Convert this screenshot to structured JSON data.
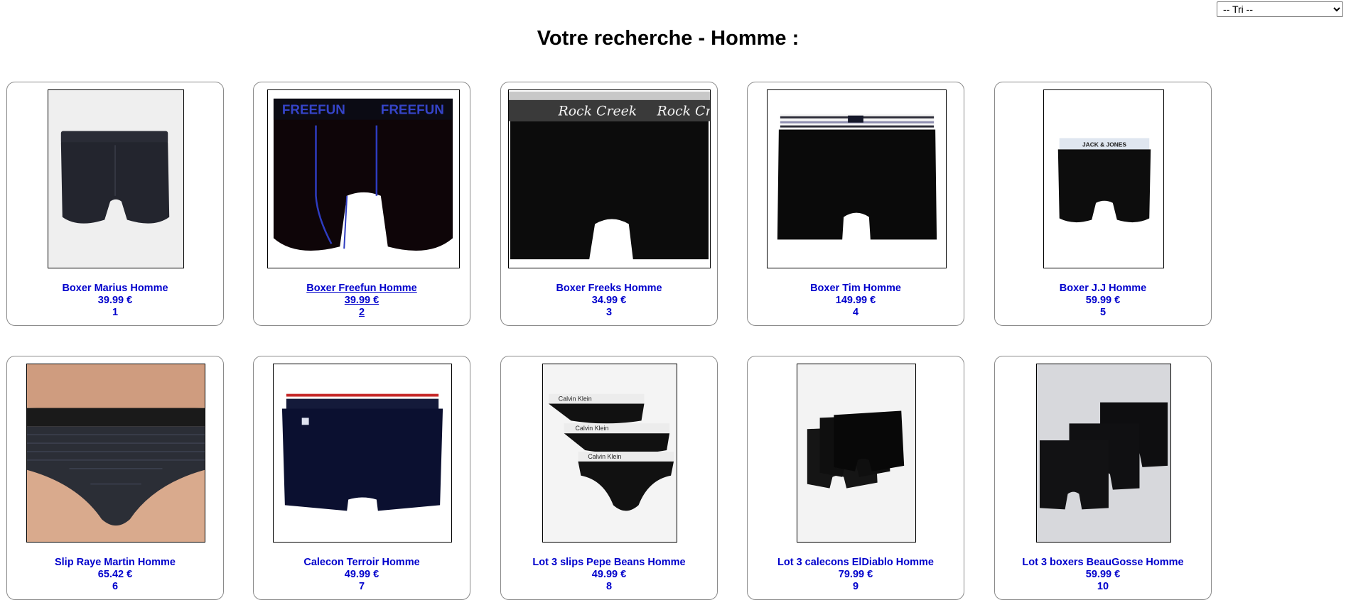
{
  "sort": {
    "selected": "-- Tri --"
  },
  "title": "Votre recherche - Homme :",
  "products": [
    {
      "name": "Boxer Marius Homme",
      "price": "39.99 €",
      "id": "1"
    },
    {
      "name": "Boxer Freefun Homme",
      "price": "39.99 €",
      "id": "2"
    },
    {
      "name": "Boxer Freeks Homme",
      "price": "34.99 €",
      "id": "3"
    },
    {
      "name": "Boxer Tim Homme",
      "price": "149.99 €",
      "id": "4"
    },
    {
      "name": "Boxer J.J Homme",
      "price": "59.99 €",
      "id": "5"
    },
    {
      "name": "Slip Raye Martin Homme",
      "price": "65.42 €",
      "id": "6"
    },
    {
      "name": "Calecon Terroir Homme",
      "price": "49.99 €",
      "id": "7"
    },
    {
      "name": "Lot 3 slips Pepe Beans Homme",
      "price": "49.99 €",
      "id": "8"
    },
    {
      "name": "Lot 3 calecons ElDiablo Homme",
      "price": "79.99 €",
      "id": "9"
    },
    {
      "name": "Lot 3 boxers BeauGosse Homme",
      "price": "59.99 €",
      "id": "10"
    }
  ],
  "photo_text": {
    "freefun_brand": "FREEFUN",
    "freeks_brand": "Rock Creek",
    "jj_brand": "JACK & JONES",
    "ck_brand": "Calvin Klein"
  }
}
